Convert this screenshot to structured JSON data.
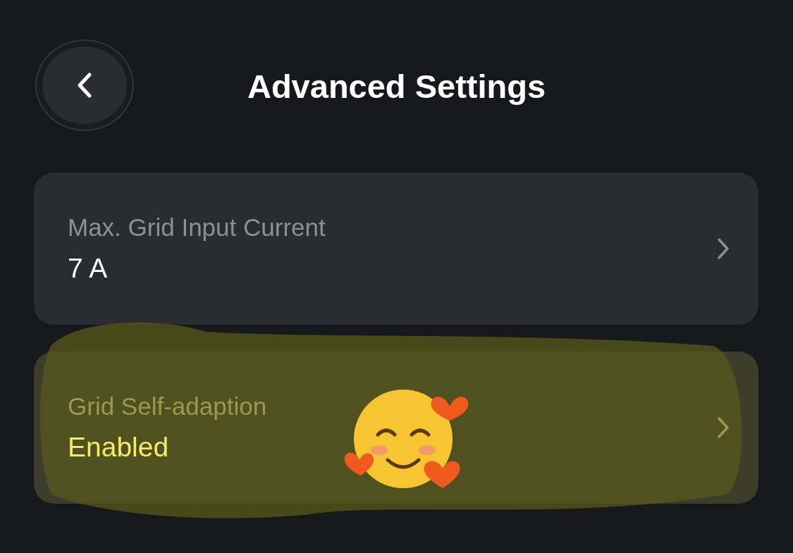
{
  "header": {
    "title": "Advanced Settings"
  },
  "settings": [
    {
      "label": "Max. Grid Input Current",
      "value": "7 A",
      "highlighted": false,
      "sticker": false
    },
    {
      "label": "Grid Self-adaption",
      "value": "Enabled",
      "highlighted": true,
      "sticker": true
    }
  ]
}
